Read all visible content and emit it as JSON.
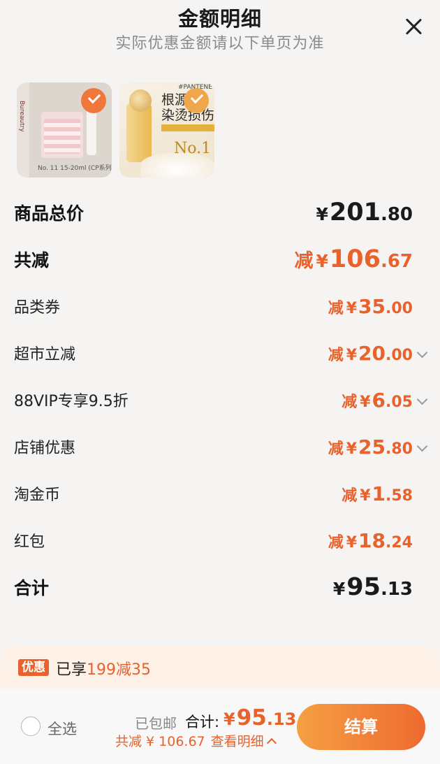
{
  "header": {
    "title": "金额明细",
    "subtitle": "实际优惠金额请以下单页为准"
  },
  "products": [
    {
      "selected": true,
      "side_text": "Bureautry",
      "caption": "No. 11 15-20ml (CP系列)"
    },
    {
      "selected": true,
      "brand_text": "#PANTENE",
      "headline": "根源\n染烫损伤",
      "badge": "No.1"
    }
  ],
  "summary": {
    "goods_total": {
      "label": "商品总价",
      "yen": "¥",
      "int": "201",
      "dec": ".80"
    },
    "total_discount": {
      "label": "共减",
      "prefix": "减",
      "yen": "¥",
      "int": "106",
      "dec": ".67"
    },
    "discounts": [
      {
        "label": "品类券",
        "prefix": "减",
        "yen": "¥",
        "int": "35",
        "dec": ".00",
        "expandable": false
      },
      {
        "label": "超市立减",
        "prefix": "减",
        "yen": "¥",
        "int": "20",
        "dec": ".00",
        "expandable": true
      },
      {
        "label": "88VIP专享9.5折",
        "prefix": "减",
        "yen": "¥",
        "int": "6",
        "dec": ".05",
        "expandable": true
      },
      {
        "label": "店铺优惠",
        "prefix": "减",
        "yen": "¥",
        "int": "25",
        "dec": ".80",
        "expandable": true
      },
      {
        "label": "淘金币",
        "prefix": "减",
        "yen": "¥",
        "int": "1",
        "dec": ".58",
        "expandable": false
      },
      {
        "label": "红包",
        "prefix": "减",
        "yen": "¥",
        "int": "18",
        "dec": ".24",
        "expandable": false
      }
    ],
    "total": {
      "label": "合计",
      "yen": "¥",
      "int": "95",
      "dec": ".13"
    }
  },
  "promo": {
    "badge": "优惠",
    "prefix": "已享",
    "highlight": "199减35"
  },
  "bottom_bar": {
    "select_all": "全选",
    "shipping": "已包邮",
    "total_label": "合计:",
    "total_yen": "¥",
    "total_int": "95",
    "total_dec": ".13",
    "discount_text": "共减 ¥ 106.67",
    "detail_link": "查看明细",
    "checkout": "结算"
  },
  "colors": {
    "accent": "#e9622c",
    "checkout_gradient_start": "#f5a043",
    "checkout_gradient_end": "#ef6a30",
    "background": "#f5f4f3"
  }
}
